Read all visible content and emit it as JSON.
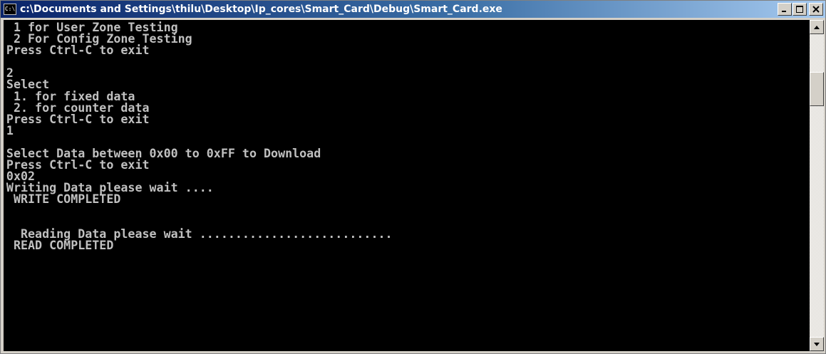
{
  "window": {
    "title": "c:\\Documents and Settings\\thilu\\Desktop\\Ip_cores\\Smart_Card\\Debug\\Smart_Card.exe",
    "icon_text": "C:\\",
    "icon": "console-icon"
  },
  "title_buttons": {
    "minimize_icon": "minimize-icon",
    "maximize_icon": "maximize-icon",
    "close_icon": "close-icon"
  },
  "console": {
    "background": "#000000",
    "foreground": "#c0c0c0",
    "lines": [
      " 1 for User Zone Testing",
      " 2 For Config Zone Testing",
      "Press Ctrl-C to exit",
      "",
      "2",
      "Select",
      " 1. for fixed data",
      " 2. for counter data",
      "Press Ctrl-C to exit",
      "1",
      "",
      "Select Data between 0x00 to 0xFF to Download",
      "Press Ctrl-C to exit",
      "0x02",
      "Writing Data please wait ....",
      " WRITE COMPLETED",
      "",
      "",
      "  Reading Data please wait ...........................",
      " READ COMPLETED"
    ]
  },
  "scrollbar": {
    "up_icon": "scroll-up-arrow-icon",
    "down_icon": "scroll-down-arrow-icon"
  }
}
